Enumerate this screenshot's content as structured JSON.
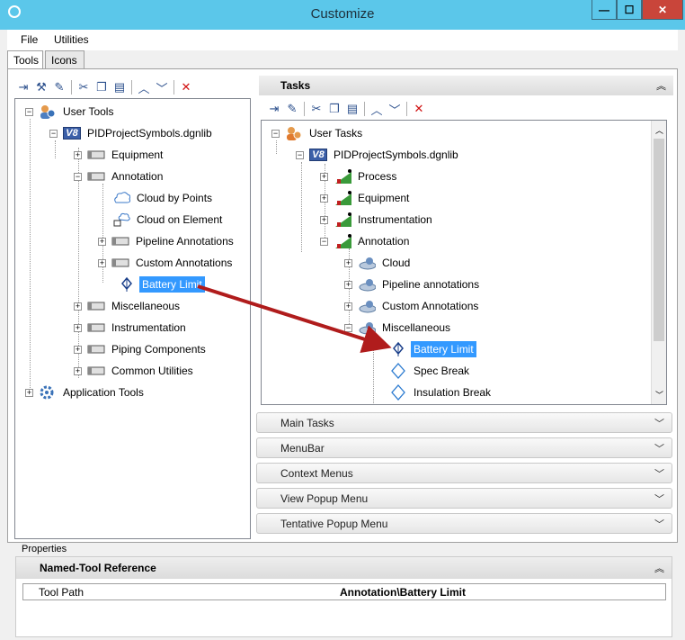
{
  "window": {
    "title": "Customize"
  },
  "menu": [
    "File",
    "Utilities"
  ],
  "tabs": [
    "Tools",
    "Icons"
  ],
  "left_tree": {
    "user_tools": "User Tools",
    "library": "PIDProjectSymbols.dgnlib",
    "equipment": "Equipment",
    "annotation": "Annotation",
    "cloud_by_points": "Cloud by Points",
    "cloud_on_element": "Cloud on Element",
    "pipeline_annotations": "Pipeline Annotations",
    "custom_annotations": "Custom Annotations",
    "battery_limit": "Battery Limit",
    "miscellaneous": "Miscellaneous",
    "instrumentation": "Instrumentation",
    "piping_components": "Piping Components",
    "common_utilities": "Common Utilities",
    "application_tools": "Application Tools"
  },
  "tasks": {
    "header": "Tasks",
    "user_tasks": "User Tasks",
    "library": "PIDProjectSymbols.dgnlib",
    "process": "Process",
    "equipment": "Equipment",
    "instrumentation": "Instrumentation",
    "annotation": "Annotation",
    "cloud": "Cloud",
    "pipeline_annotations": "Pipeline annotations",
    "custom_annotations": "Custom Annotations",
    "miscellaneous": "Miscellaneous",
    "battery_limit": "Battery Limit",
    "spec_break": "Spec Break",
    "insulation_break": "Insulation Break"
  },
  "sections": [
    "Main Tasks",
    "MenuBar",
    "Context Menus",
    "View Popup Menu",
    "Tentative Popup Menu"
  ],
  "properties": {
    "label": "Properties",
    "header": "Named-Tool Reference",
    "tool_path_label": "Tool Path",
    "tool_path_value": "Annotation\\Battery Limit"
  },
  "colors": {
    "titlebar": "#5bc7ea",
    "selection": "#3399ff",
    "arrow": "#b01c1c",
    "close": "#c9453a"
  }
}
